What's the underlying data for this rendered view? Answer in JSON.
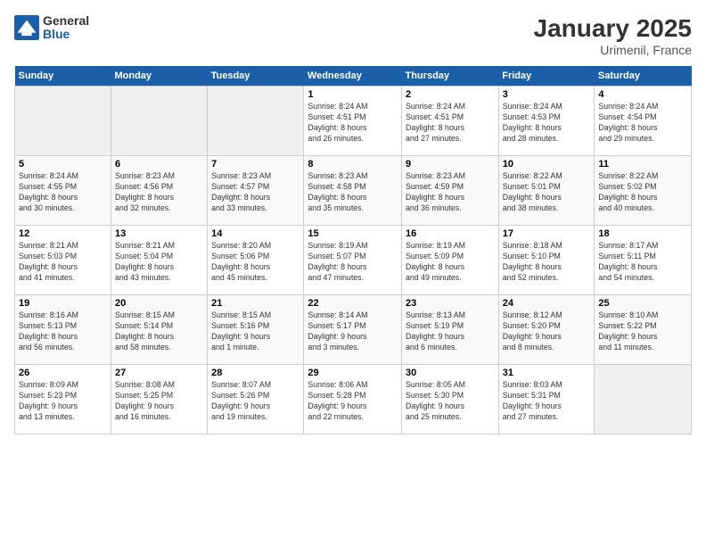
{
  "logo": {
    "general": "General",
    "blue": "Blue"
  },
  "title": "January 2025",
  "location": "Urimenil, France",
  "weekdays": [
    "Sunday",
    "Monday",
    "Tuesday",
    "Wednesday",
    "Thursday",
    "Friday",
    "Saturday"
  ],
  "weeks": [
    [
      {
        "day": "",
        "info": ""
      },
      {
        "day": "",
        "info": ""
      },
      {
        "day": "",
        "info": ""
      },
      {
        "day": "1",
        "info": "Sunrise: 8:24 AM\nSunset: 4:51 PM\nDaylight: 8 hours\nand 26 minutes."
      },
      {
        "day": "2",
        "info": "Sunrise: 8:24 AM\nSunset: 4:51 PM\nDaylight: 8 hours\nand 27 minutes."
      },
      {
        "day": "3",
        "info": "Sunrise: 8:24 AM\nSunset: 4:53 PM\nDaylight: 8 hours\nand 28 minutes."
      },
      {
        "day": "4",
        "info": "Sunrise: 8:24 AM\nSunset: 4:54 PM\nDaylight: 8 hours\nand 29 minutes."
      }
    ],
    [
      {
        "day": "5",
        "info": "Sunrise: 8:24 AM\nSunset: 4:55 PM\nDaylight: 8 hours\nand 30 minutes."
      },
      {
        "day": "6",
        "info": "Sunrise: 8:23 AM\nSunset: 4:56 PM\nDaylight: 8 hours\nand 32 minutes."
      },
      {
        "day": "7",
        "info": "Sunrise: 8:23 AM\nSunset: 4:57 PM\nDaylight: 8 hours\nand 33 minutes."
      },
      {
        "day": "8",
        "info": "Sunrise: 8:23 AM\nSunset: 4:58 PM\nDaylight: 8 hours\nand 35 minutes."
      },
      {
        "day": "9",
        "info": "Sunrise: 8:23 AM\nSunset: 4:59 PM\nDaylight: 8 hours\nand 36 minutes."
      },
      {
        "day": "10",
        "info": "Sunrise: 8:22 AM\nSunset: 5:01 PM\nDaylight: 8 hours\nand 38 minutes."
      },
      {
        "day": "11",
        "info": "Sunrise: 8:22 AM\nSunset: 5:02 PM\nDaylight: 8 hours\nand 40 minutes."
      }
    ],
    [
      {
        "day": "12",
        "info": "Sunrise: 8:21 AM\nSunset: 5:03 PM\nDaylight: 8 hours\nand 41 minutes."
      },
      {
        "day": "13",
        "info": "Sunrise: 8:21 AM\nSunset: 5:04 PM\nDaylight: 8 hours\nand 43 minutes."
      },
      {
        "day": "14",
        "info": "Sunrise: 8:20 AM\nSunset: 5:06 PM\nDaylight: 8 hours\nand 45 minutes."
      },
      {
        "day": "15",
        "info": "Sunrise: 8:19 AM\nSunset: 5:07 PM\nDaylight: 8 hours\nand 47 minutes."
      },
      {
        "day": "16",
        "info": "Sunrise: 8:19 AM\nSunset: 5:09 PM\nDaylight: 8 hours\nand 49 minutes."
      },
      {
        "day": "17",
        "info": "Sunrise: 8:18 AM\nSunset: 5:10 PM\nDaylight: 8 hours\nand 52 minutes."
      },
      {
        "day": "18",
        "info": "Sunrise: 8:17 AM\nSunset: 5:11 PM\nDaylight: 8 hours\nand 54 minutes."
      }
    ],
    [
      {
        "day": "19",
        "info": "Sunrise: 8:16 AM\nSunset: 5:13 PM\nDaylight: 8 hours\nand 56 minutes."
      },
      {
        "day": "20",
        "info": "Sunrise: 8:15 AM\nSunset: 5:14 PM\nDaylight: 8 hours\nand 58 minutes."
      },
      {
        "day": "21",
        "info": "Sunrise: 8:15 AM\nSunset: 5:16 PM\nDaylight: 9 hours\nand 1 minute."
      },
      {
        "day": "22",
        "info": "Sunrise: 8:14 AM\nSunset: 5:17 PM\nDaylight: 9 hours\nand 3 minutes."
      },
      {
        "day": "23",
        "info": "Sunrise: 8:13 AM\nSunset: 5:19 PM\nDaylight: 9 hours\nand 6 minutes."
      },
      {
        "day": "24",
        "info": "Sunrise: 8:12 AM\nSunset: 5:20 PM\nDaylight: 9 hours\nand 8 minutes."
      },
      {
        "day": "25",
        "info": "Sunrise: 8:10 AM\nSunset: 5:22 PM\nDaylight: 9 hours\nand 11 minutes."
      }
    ],
    [
      {
        "day": "26",
        "info": "Sunrise: 8:09 AM\nSunset: 5:23 PM\nDaylight: 9 hours\nand 13 minutes."
      },
      {
        "day": "27",
        "info": "Sunrise: 8:08 AM\nSunset: 5:25 PM\nDaylight: 9 hours\nand 16 minutes."
      },
      {
        "day": "28",
        "info": "Sunrise: 8:07 AM\nSunset: 5:26 PM\nDaylight: 9 hours\nand 19 minutes."
      },
      {
        "day": "29",
        "info": "Sunrise: 8:06 AM\nSunset: 5:28 PM\nDaylight: 9 hours\nand 22 minutes."
      },
      {
        "day": "30",
        "info": "Sunrise: 8:05 AM\nSunset: 5:30 PM\nDaylight: 9 hours\nand 25 minutes."
      },
      {
        "day": "31",
        "info": "Sunrise: 8:03 AM\nSunset: 5:31 PM\nDaylight: 9 hours\nand 27 minutes."
      },
      {
        "day": "",
        "info": ""
      }
    ]
  ]
}
